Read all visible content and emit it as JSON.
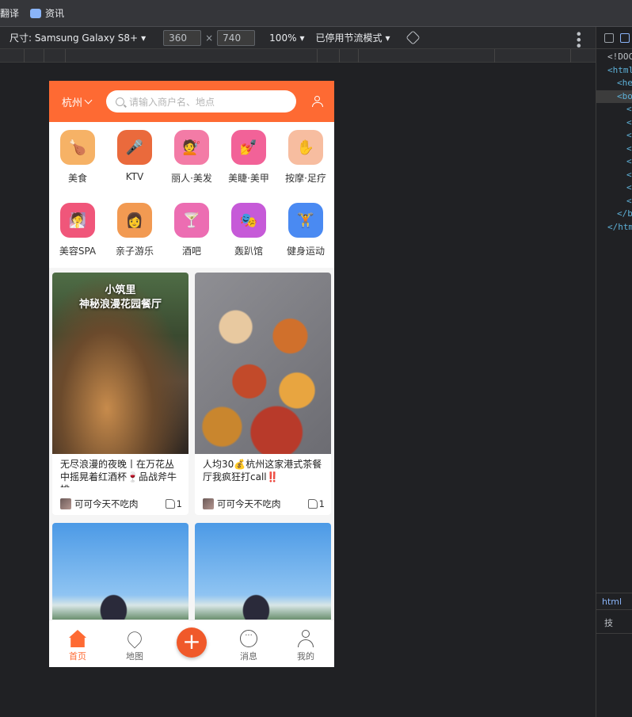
{
  "browser": {
    "bookmarks": [
      {
        "label": "翻译"
      },
      {
        "label": "资讯"
      }
    ],
    "device_toolbar": {
      "device_label": "尺寸: Samsung Galaxy S8+",
      "width": "360",
      "height": "740",
      "zoom": "100%",
      "throttle": "已停用节流模式",
      "times": "×"
    }
  },
  "devtools": {
    "dom_lines": [
      "<!DOC",
      "<html",
      "<he",
      "<bo",
      "<",
      "<",
      "<",
      "<",
      "<",
      "<",
      "<",
      "<",
      "</b",
      "</htm"
    ],
    "crumb": "html",
    "sub": "技"
  },
  "app": {
    "colors": {
      "accent": "#fe6a33"
    },
    "header": {
      "city": "杭州",
      "search_placeholder": "请输入商户名、地点"
    },
    "categories": [
      {
        "label": "美食",
        "color": "#f5a04a",
        "glyph": "🍗"
      },
      {
        "label": "KTV",
        "color": "#e2572e",
        "glyph": "🎤"
      },
      {
        "label": "丽人·美发",
        "color": "#f2689a",
        "glyph": "💇"
      },
      {
        "label": "美睫·美甲",
        "color": "#f0508a",
        "glyph": "💅"
      },
      {
        "label": "按摩·足疗",
        "color": "#f6b08e",
        "glyph": "✋"
      },
      {
        "label": "美容SPA",
        "color": "#f04c6a",
        "glyph": "🧖"
      },
      {
        "label": "亲子游乐",
        "color": "#f28a3c",
        "glyph": "👩"
      },
      {
        "label": "酒吧",
        "color": "#e85aa6",
        "glyph": "🍸"
      },
      {
        "label": "轰趴馆",
        "color": "#c24ad6",
        "glyph": "🎭"
      },
      {
        "label": "健身运动",
        "color": "#3a7df0",
        "glyph": "🏋"
      }
    ],
    "feed": [
      {
        "image_text": "小筑里\n神秘浪漫花园餐厅",
        "title": "无尽浪漫的夜晚丨在万花丛中摇晃着红酒杯🍷品战斧牛排",
        "author": "可可今天不吃肉",
        "likes": "1"
      },
      {
        "image_text": "",
        "title": "人均30💰杭州这家港式茶餐厅我疯狂打call‼️",
        "author": "可可今天不吃肉",
        "likes": "1"
      },
      {
        "image_text": "",
        "title": "",
        "author": "",
        "likes": ""
      },
      {
        "image_text": "",
        "title": "",
        "author": "",
        "likes": ""
      }
    ],
    "tabbar": [
      {
        "label": "首页"
      },
      {
        "label": "地图"
      },
      {
        "label": ""
      },
      {
        "label": "消息"
      },
      {
        "label": "我的"
      }
    ],
    "plus_symbol": "+"
  }
}
